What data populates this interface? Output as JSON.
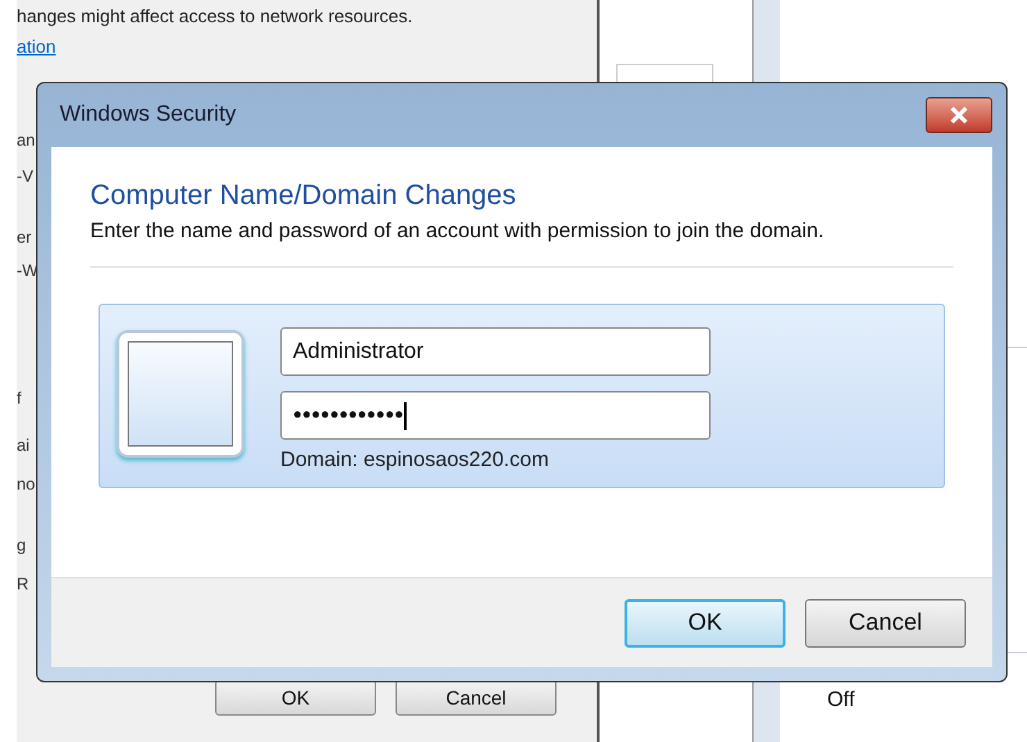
{
  "background": {
    "notice": "hanges might affect access to network resources.",
    "link": "ation",
    "edge_fragments": [
      "an",
      "-V",
      "er",
      "-W",
      "f",
      "ai",
      "no",
      "g",
      "R"
    ],
    "buttons": [
      "OK",
      "Cancel"
    ],
    "right_value": "Off"
  },
  "dialog": {
    "title": "Windows Security",
    "heading": "Computer Name/Domain Changes",
    "description": "Enter the name and password of an account with permission to join the domain.",
    "username": {
      "value": "Administrator"
    },
    "password": {
      "value": "●●●●●●●●●●●●",
      "focused": true
    },
    "domain": "Domain: espinosaos220.com",
    "buttons": [
      {
        "label": "OK",
        "default": true
      },
      {
        "label": "Cancel",
        "default": false
      }
    ]
  }
}
